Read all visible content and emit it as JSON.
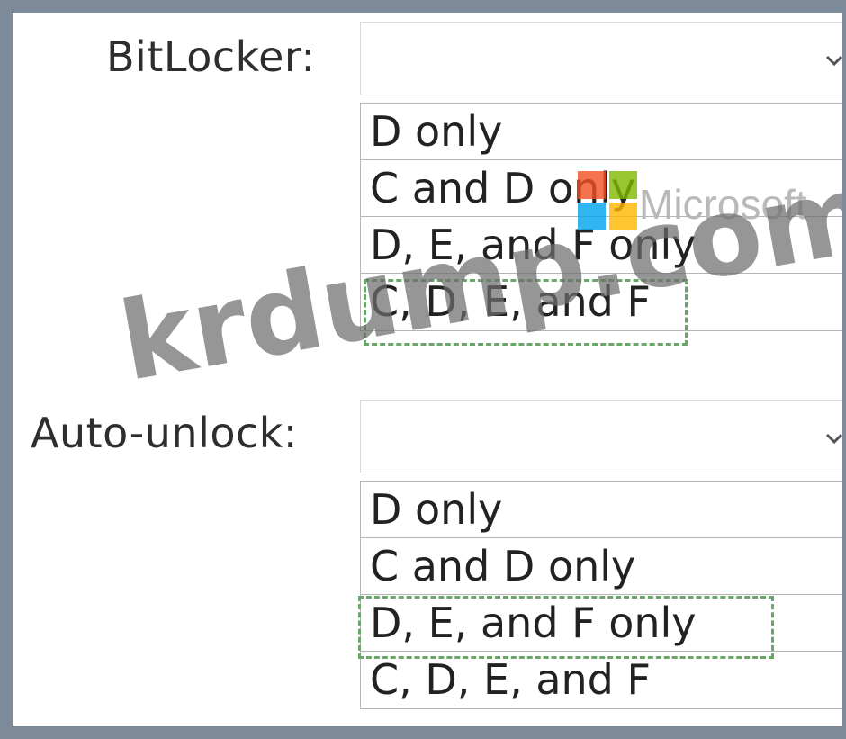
{
  "bitlocker": {
    "label": "BitLocker:",
    "options": [
      "D only",
      "C and D only",
      "D, E, and F only",
      "C, D, E, and F"
    ]
  },
  "autounlock": {
    "label": "Auto-unlock:",
    "options": [
      "D only",
      "C and D only",
      "D, E, and F only",
      "C, D, E, and F"
    ]
  },
  "logo": {
    "text": "Microsoft",
    "colors": [
      "#f25022",
      "#7fba00",
      "#00a4ef",
      "#ffb900"
    ]
  },
  "watermark": "krdump.com",
  "selection_color": "#6aa66a",
  "frame_color": "#7d8a99"
}
